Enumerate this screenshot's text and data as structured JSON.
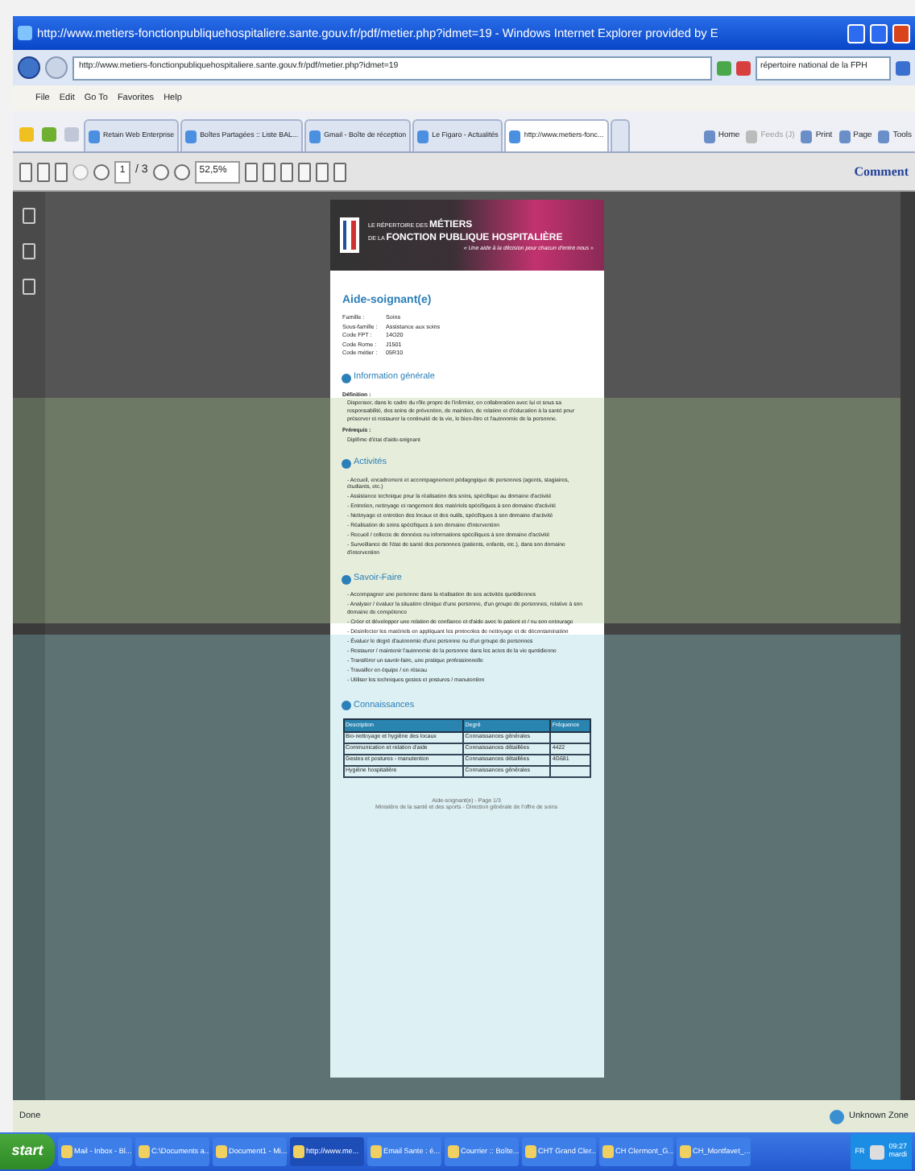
{
  "window": {
    "title": "http://www.metiers-fonctionpubliquehospitaliere.sante.gouv.fr/pdf/metier.php?idmet=19 - Windows Internet Explorer provided by E"
  },
  "address_bar": {
    "url": "http://www.metiers-fonctionpubliquehospitaliere.sante.gouv.fr/pdf/metier.php?idmet=19",
    "search_value": "répertoire national de la FPH"
  },
  "menu": [
    "File",
    "Edit",
    "Go To",
    "Favorites",
    "Help"
  ],
  "tabs": [
    {
      "label": "Retain Web Enterprise",
      "selected": false
    },
    {
      "label": "Boîtes Partagées :: Liste BAL...",
      "selected": false
    },
    {
      "label": "Gmail - Boîte de réception",
      "selected": false
    },
    {
      "label": "Le Figaro - Actualités",
      "selected": false
    },
    {
      "label": "http://www.metiers-fonc...",
      "selected": true
    }
  ],
  "command_bar": [
    {
      "label": "Home",
      "disabled": false
    },
    {
      "label": "Feeds (J)",
      "disabled": true
    },
    {
      "label": "Print",
      "disabled": false
    },
    {
      "label": "Page",
      "disabled": false
    },
    {
      "label": "Tools",
      "disabled": false
    }
  ],
  "pdf_toolbar": {
    "page": "1",
    "page_total": "/ 3",
    "zoom": "52,5%",
    "comment": "Comment"
  },
  "document": {
    "header": {
      "line_1": "LE RÉPERTOIRE DES **MÉTIERS**",
      "line_2": "DE LA **FONCTION PUBLIQUE HOSPITALIÈRE**",
      "tagline": "« Une aide à la décision pour chacun d'entre nous »"
    },
    "title": "Aide-soignant(e)",
    "fields": [
      {
        "label": "Famille :",
        "value": "Soins"
      },
      {
        "label": "Sous-famille :",
        "value": "Assistance aux soins"
      },
      {
        "label": "Code FPT :",
        "value": "14O20"
      },
      {
        "label": "Code Rome :",
        "value": "J1501"
      },
      {
        "label": "Code métier :",
        "value": "05R10"
      }
    ],
    "sections": [
      {
        "kind": "text",
        "title": "Information générale",
        "blocks": [
          {
            "label": "Définition :",
            "text": "Dispenser, dans le cadre du rôle propre de l'infirmier, en collaboration avec lui et sous sa responsabilité, des soins de prévention, de maintien, de relation et d'éducation à la santé pour préserver et restaurer la continuité de la vie, le bien-être et l'autonomie de la personne."
          },
          {
            "label": "Prérequis :",
            "text": "Diplôme d'état d'aide-soignant"
          }
        ]
      },
      {
        "kind": "list",
        "title": "Activités",
        "items": [
          "- Accueil, encadrement et accompagnement pédagogique de personnes (agents, stagiaires, étudiants, etc.)",
          "- Assistance technique pour la réalisation des soins, spécifique au domaine d'activité",
          "- Entretien, nettoyage et rangement des matériels spécifiques à son domaine d'activité",
          "- Nettoyage et entretien des locaux et des outils, spécifiques à son domaine d'activité",
          "- Réalisation de soins spécifiques à son domaine d'intervention",
          "- Recueil / collecte de données ou informations spécifiques à son domaine d'activité",
          "- Surveillance de l'état de santé des personnes (patients, enfants, etc.), dans son domaine d'intervention"
        ]
      },
      {
        "kind": "list",
        "title": "Savoir-Faire",
        "items": [
          "- Accompagner une personne dans la réalisation de ses activités quotidiennes",
          "- Analyser / évaluer la situation clinique d'une personne, d'un groupe de personnes, relative à son domaine de compétence",
          "- Créer et développer une relation de confiance et d'aide avec le patient et / ou son entourage",
          "- Désinfecter les matériels en appliquant les protocoles de nettoyage et de décontamination",
          "- Évaluer le degré d'autonomie d'une personne ou d'un groupe de personnes",
          "- Restaurer / maintenir l'autonomie de la personne dans les actes de la vie quotidienne",
          "- Transférer un savoir-faire, une pratique professionnelle",
          "- Travailler en équipe / en réseau",
          "- Utiliser les techniques gestes et postures / manutention"
        ]
      },
      {
        "kind": "table",
        "title": "Connaissances",
        "columns": [
          "Description",
          "Degré",
          "Fréquence"
        ],
        "rows": [
          [
            "Bio-nettoyage et hygiène des locaux",
            "Connaissances générales",
            ""
          ],
          [
            "Communication et relation d'aide",
            "Connaissances détaillées",
            "4422"
          ],
          [
            "Gestes et postures - manutention",
            "Connaissances détaillées",
            "4G681"
          ],
          [
            "Hygiène hospitalière",
            "Connaissances générales",
            ""
          ]
        ]
      }
    ],
    "footer": [
      "Aide-soignant(e) - Page 1/3",
      "Ministère de la santé et des sports - Direction générale de l'offre de soins"
    ]
  },
  "status_bar": {
    "status": "Done",
    "zone": "Unknown Zone"
  },
  "taskbar": {
    "start": "start",
    "items": [
      {
        "label": "Mail - Inbox - Bl...",
        "selected": false
      },
      {
        "label": "C:\\Documents a...",
        "selected": false
      },
      {
        "label": "Document1 - Mi...",
        "selected": false
      },
      {
        "label": "http://www.me...",
        "selected": true
      },
      {
        "label": "Email Sante : é...",
        "selected": false
      },
      {
        "label": "Courrier :: Boîte...",
        "selected": false
      },
      {
        "label": "CHT Grand Cler...",
        "selected": false
      },
      {
        "label": "CH Clermont_G...",
        "selected": false
      },
      {
        "label": "CH_Montfavet_...",
        "selected": false
      }
    ],
    "language": "FR",
    "time": "09:27",
    "day": "mardi"
  }
}
